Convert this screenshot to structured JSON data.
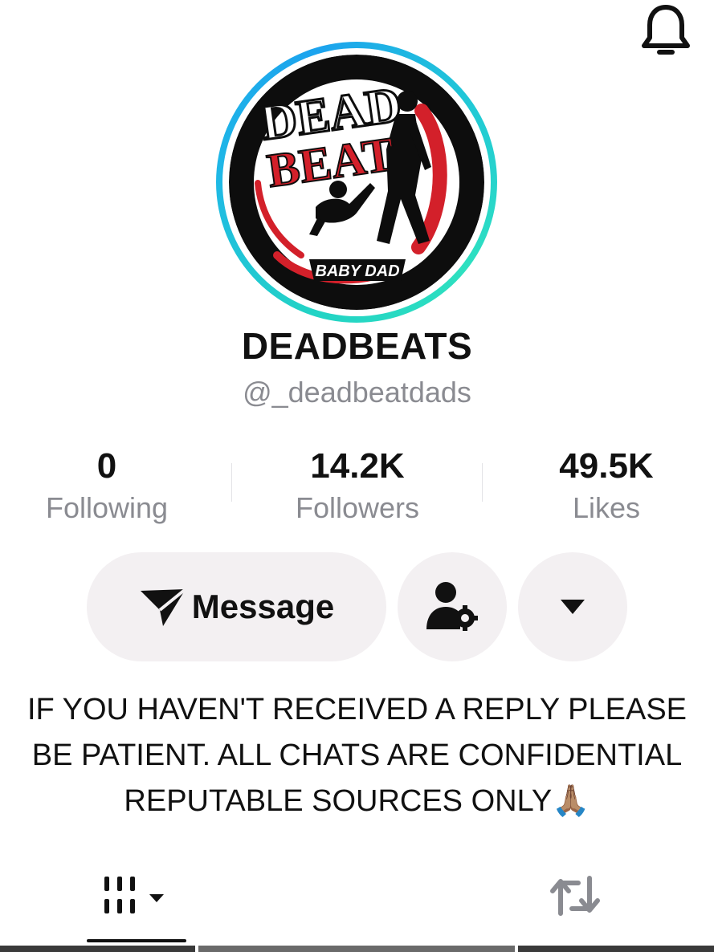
{
  "header": {
    "bell_icon": "bell-icon"
  },
  "profile": {
    "avatar_brand": {
      "line1": "DEAD",
      "line2": "BEAT",
      "tagline": "BABY DAD"
    },
    "display_name": "DEADBEATS",
    "username": "@_deadbeatdads"
  },
  "stats": [
    {
      "value": "0",
      "label": "Following"
    },
    {
      "value": "14.2K",
      "label": "Followers"
    },
    {
      "value": "49.5K",
      "label": "Likes"
    }
  ],
  "actions": {
    "message_label": "Message",
    "message_icon": "send-icon",
    "add_friend_icon": "person-settings-icon",
    "more_icon": "caret-down-icon"
  },
  "bio": {
    "lines": [
      "IF YOU HAVEN'T RECEIVED A REPLY PLEASE",
      "BE PATIENT. ALL CHATS ARE CONFIDENTIAL",
      "REPUTABLE SOURCES ONLY"
    ],
    "emoji": "🙏🏽"
  },
  "tabs": [
    {
      "icon": "grid-filter-icon"
    },
    {
      "icon": "repost-icon"
    }
  ],
  "colors": {
    "ring_start": "#1ca3ee",
    "ring_end": "#2ee0c0",
    "button_bg": "#f3f0f2",
    "muted_text": "#8a8b91",
    "brand_red": "#d3202a"
  }
}
